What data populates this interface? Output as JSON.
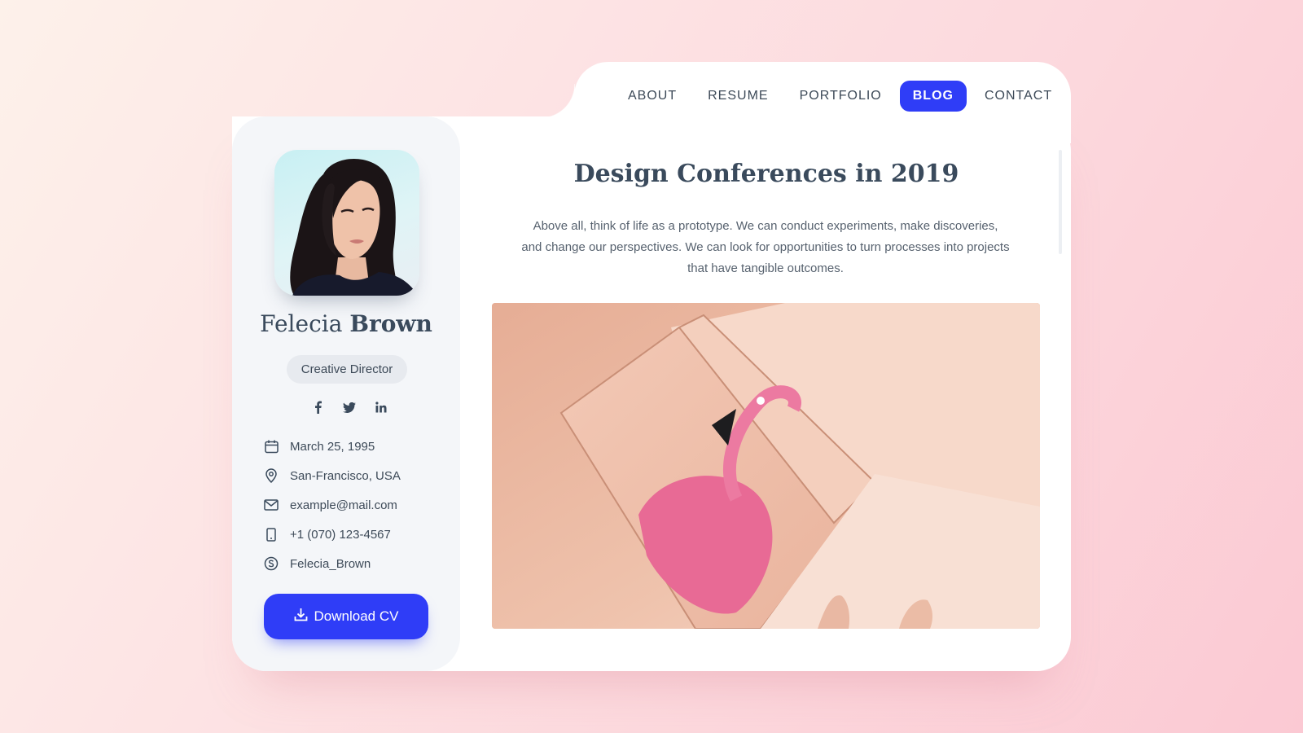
{
  "nav": {
    "items": [
      {
        "label": "ABOUT",
        "active": false
      },
      {
        "label": "RESUME",
        "active": false
      },
      {
        "label": "PORTFOLIO",
        "active": false
      },
      {
        "label": "BLOG",
        "active": true
      },
      {
        "label": "CONTACT",
        "active": false
      }
    ],
    "active_color": "#2f3df7"
  },
  "profile": {
    "first_name": "Felecia",
    "last_name": "Brown",
    "role": "Creative Director",
    "socials": [
      {
        "icon": "facebook-icon"
      },
      {
        "icon": "twitter-icon"
      },
      {
        "icon": "linkedin-icon"
      }
    ],
    "info": [
      {
        "icon": "calendar-icon",
        "text": "March 25, 1995"
      },
      {
        "icon": "location-pin-icon",
        "text": "San-Francisco, USA"
      },
      {
        "icon": "envelope-icon",
        "text": "example@mail.com"
      },
      {
        "icon": "phone-icon",
        "text": "+1 (070) 123-4567"
      },
      {
        "icon": "skype-icon",
        "text": "Felecia_Brown"
      }
    ],
    "download_label": "Download CV"
  },
  "post": {
    "title": "Design Conferences in 2019",
    "excerpt": "Above all, think of life as a prototype. We can conduct experiments, make discoveries, and change our perspectives. We can look for opportunities to turn processes into projects that have tangible outcomes."
  },
  "colors": {
    "accent": "#2f3df7",
    "text": "#3a4a5c",
    "sidebar_bg": "#f4f6f9"
  }
}
